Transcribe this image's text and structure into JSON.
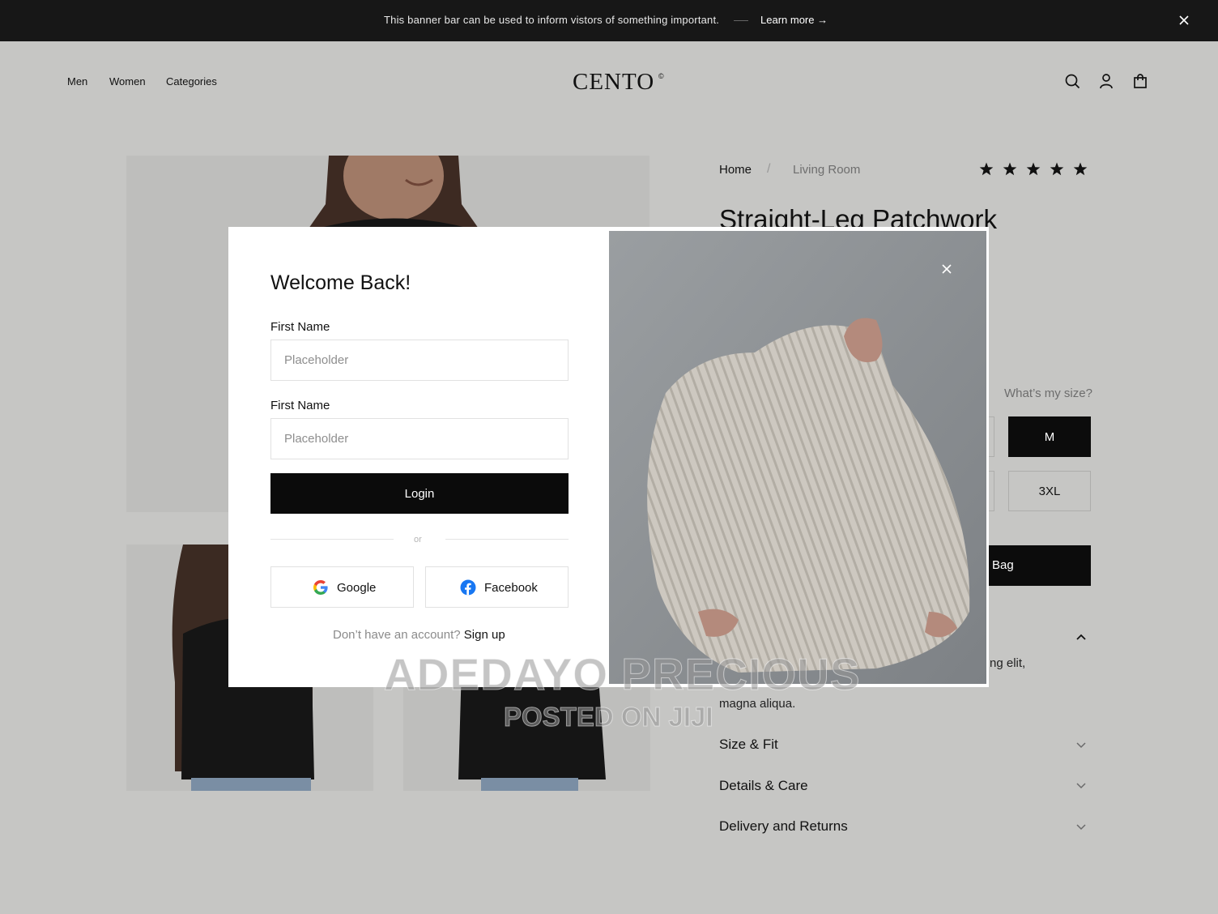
{
  "banner": {
    "message": "This banner bar can be used to inform vistors of something important.",
    "link_label": "Learn more →",
    "close_icon": "close-icon"
  },
  "header": {
    "nav": [
      "Men",
      "Women",
      "Categories"
    ],
    "logo": "CENTO",
    "logo_mark": "©",
    "icons": [
      "search-icon",
      "user-icon",
      "bag-icon"
    ]
  },
  "product": {
    "breadcrumb": [
      "Home",
      "Living Room"
    ],
    "breadcrumb_separator": "/",
    "rating_stars": 5,
    "title": "Straight-Leg Patchwork",
    "size_help": "What’s my size?",
    "sizes_visible": [
      "M",
      "3XL"
    ],
    "selected_size": "M",
    "add_to_bag_partial": "Bag",
    "description_partial": [
      "ng elit,",
      "magna aliqua."
    ],
    "accordions": [
      "Size & Fit",
      "Details & Care",
      "Delivery and Returns"
    ]
  },
  "modal": {
    "title": "Welcome Back!",
    "field1_label": "First Name",
    "field1_placeholder": "Placeholder",
    "field2_label": "First Name",
    "field2_placeholder": "Placeholder",
    "login_label": "Login",
    "divider_text": "or",
    "google_label": "Google",
    "facebook_label": "Facebook",
    "footer_prompt": "Don’t have an account?",
    "footer_link": "Sign up"
  },
  "watermark": {
    "line1": "ADEDAYO PRECIOUS",
    "line2": "POSTED ON JIJI"
  },
  "colors": {
    "page_bg": "#c6c6c4",
    "banner_bg": "#171717",
    "primary_button": "#0b0b0b",
    "modal_bg": "#ffffff"
  }
}
